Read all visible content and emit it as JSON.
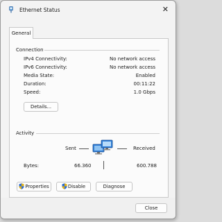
{
  "window": {
    "title": "Ethernet Status"
  },
  "tabs": [
    {
      "label": "General"
    }
  ],
  "connection": {
    "heading": "Connection",
    "rows": [
      {
        "label": "IPv4 Connectivity:",
        "value": "No network access"
      },
      {
        "label": "IPv6 Connectivity:",
        "value": "No network access"
      },
      {
        "label": "Media State:",
        "value": "Enabled"
      },
      {
        "label": "Duration:",
        "value": "00:11:22"
      },
      {
        "label": "Speed:",
        "value": "1.0 Gbps"
      }
    ],
    "details_label": "Details..."
  },
  "activity": {
    "heading": "Activity",
    "sent_label": "Sent",
    "received_label": "Received",
    "bytes_label": "Bytes:",
    "bytes_sent": "66.360",
    "bytes_received": "600.788"
  },
  "actions": {
    "properties_label": "Properties",
    "disable_label": "Disable",
    "diagnose_label": "Diagnose"
  },
  "footer": {
    "close_label": "Close"
  },
  "icons": {
    "title": "ethernet-icon",
    "close": "close-icon",
    "network": "network-computers-icon",
    "shield": "uac-shield-icon"
  },
  "colors": {
    "shield_blue": "#2b6cd6",
    "shield_yellow": "#e7b416",
    "monitor_blue": "#2f7fd8"
  }
}
